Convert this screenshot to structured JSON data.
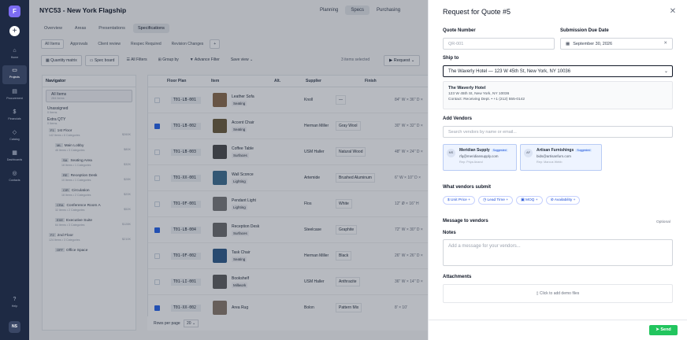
{
  "rail": {
    "logo": "F",
    "items": [
      {
        "label": "Home",
        "icon": "home-icon",
        "glyph": "⌂"
      },
      {
        "label": "Projects",
        "icon": "folder-icon",
        "glyph": "▭"
      },
      {
        "label": "Procurement",
        "icon": "document-icon",
        "glyph": "▤"
      },
      {
        "label": "Financials",
        "icon": "dollar-icon",
        "glyph": "$"
      },
      {
        "label": "Catalog",
        "icon": "box-icon",
        "glyph": "◇"
      },
      {
        "label": "Dashboards",
        "icon": "grid-icon",
        "glyph": "▦"
      },
      {
        "label": "Contacts",
        "icon": "contacts-icon",
        "glyph": "◎"
      }
    ],
    "help_label": "Help",
    "avatar": "NS"
  },
  "header": {
    "title": "NYC53 - New York Flagship",
    "modes": [
      "Planning",
      "Specs",
      "Purchasing"
    ]
  },
  "tabs_primary": [
    "Overview",
    "Areas",
    "Presentations",
    "Specifications"
  ],
  "tabs_secondary": [
    "All Items",
    "Approvals",
    "Client review",
    "Respec Required",
    "Revision Changes"
  ],
  "toolbar": {
    "quantity_matrix": "Quantity matrix",
    "spec_board": "Spec board",
    "all_filters": "All Filters",
    "group_by": "Group by",
    "advance_filter": "Advance Filter",
    "save_view": "Save view",
    "selected_info": "3 items selected",
    "request": "Request"
  },
  "navigator": {
    "title": "Navigator",
    "all_items": {
      "label": "All Items",
      "sub": "284 Items"
    },
    "unassigned": {
      "label": "Unassigned",
      "sub": "0 Items"
    },
    "extra_qty": {
      "label": "Extra QTY",
      "sub": "0 Items"
    },
    "tree": [
      {
        "code": "F1",
        "name": "1st Floor",
        "meta": "142 Items  •  6 Categories",
        "amt": "$260K",
        "indent": 0
      },
      {
        "code": "ML",
        "name": "Main Lobby",
        "meta": "46 Items  •  3 Categories",
        "amt": "$80K",
        "indent": 1
      },
      {
        "code": "SA",
        "name": "Seating Area",
        "meta": "18 Items  •  1 Categories",
        "amt": "$32K",
        "indent": 2
      },
      {
        "code": "RE",
        "name": "Reception Desk",
        "meta": "10 Items  •  1 Categories",
        "amt": "$28K",
        "indent": 2
      },
      {
        "code": "CIR",
        "name": "Circulation",
        "meta": "18 Items  •  2 Categories",
        "amt": "$20K",
        "indent": 2
      },
      {
        "code": "CRA",
        "name": "Conference Room A",
        "meta": "32 Items  •  2 Categories",
        "amt": "$52K",
        "indent": 1
      },
      {
        "code": "EXE",
        "name": "Executive Suite",
        "meta": "64 Items  •  3 Categories",
        "amt": "$128K",
        "indent": 1
      },
      {
        "code": "F2",
        "name": "2nd Floor",
        "meta": "124 Items  •  3 Categories",
        "amt": "$210K",
        "indent": 0
      },
      {
        "code": "OFF",
        "name": "Office Space",
        "meta": "",
        "amt": "",
        "indent": 1
      }
    ]
  },
  "grid": {
    "headers": [
      "Floor Plan",
      "Item",
      "Alt.",
      "Supplier",
      "Finish"
    ],
    "rows": [
      {
        "plan": "T01-LB-001",
        "item": "Leather Sofa",
        "cat": "Seating",
        "alt": "Knoll",
        "sup": "—",
        "fin": "84\" W × 36\" D ×",
        "checked": false,
        "thumb": "#8b6b4a"
      },
      {
        "plan": "T01-LB-002",
        "item": "Accent Chair",
        "cat": "Seating",
        "alt": "Herman Miller",
        "sup": "Gray Wool",
        "fin": "30\" W × 32\" D ×",
        "checked": true,
        "thumb": "#6b5b3a"
      },
      {
        "plan": "T01-LB-003",
        "item": "Coffee Table",
        "cat": "Surfaces",
        "alt": "USM Haller",
        "sup": "Natural Wood",
        "fin": "48\" W × 24\" D ×",
        "checked": false,
        "thumb": "#4a4a4a"
      },
      {
        "plan": "T01-XX-001",
        "item": "Wall Sconce",
        "cat": "Lighting",
        "alt": "Artemide",
        "sup": "Brushed Aluminum",
        "fin": "6\" W × 10\" D ×",
        "checked": false,
        "thumb": "#3d6e8f"
      },
      {
        "plan": "T01-OF-001",
        "item": "Pendant Light",
        "cat": "Lighting",
        "alt": "Flos",
        "sup": "White",
        "fin": "12\" Ø × 16\" H",
        "checked": false,
        "thumb": "#7a7a7a"
      },
      {
        "plan": "T01-LB-004",
        "item": "Reception Desk",
        "cat": "Surfaces",
        "alt": "Steelcase",
        "sup": "Graphite",
        "fin": "72\" W × 30\" D ×",
        "checked": true,
        "thumb": "#6c6c6c"
      },
      {
        "plan": "T01-OF-002",
        "item": "Task Chair",
        "cat": "Seating",
        "alt": "Herman Miller",
        "sup": "Black",
        "fin": "26\" W × 26\" D ×",
        "checked": false,
        "thumb": "#2e5a8a"
      },
      {
        "plan": "T01-LI-001",
        "item": "Bookshelf",
        "cat": "Millwork",
        "alt": "USM Haller",
        "sup": "Anthracite",
        "fin": "36\" W × 14\" D ×",
        "checked": false,
        "thumb": "#5e5e5e"
      },
      {
        "plan": "T01-XX-002",
        "item": "Area Rug",
        "cat": "",
        "alt": "Bolon",
        "sup": "Pattern Mix",
        "fin": "8' × 10'",
        "checked": true,
        "thumb": "#8a7a6a"
      }
    ],
    "rows_per_page_label": "Rows per page",
    "rows_per_page": "20"
  },
  "panel": {
    "title": "Request for Quote #5",
    "quote_number_label": "Quote Number",
    "quote_number_placeholder": "QR-001",
    "due_label": "Submission Due Date",
    "due_value": "September 30, 2026",
    "ship_to_label": "Ship to",
    "ship_to_value": "The Waverly Hotel — 123 W 45th St, New York, NY 10036",
    "address": {
      "name": "The Waverly Hotel",
      "line1": "123 W 45th St, New York, NY 10036",
      "line2": "Contact: Receiving Dept.  •  +1 (212) 555-0142"
    },
    "add_vendors_label": "Add Vendors",
    "vendor_search_placeholder": "Search vendors by name or email...",
    "vendors": [
      {
        "initials": "MS",
        "name": "Meridian Supply",
        "badge": "Suggested",
        "email": "rfq@meridiansupply.com",
        "rep": "Rep: Priya Anand"
      },
      {
        "initials": "AF",
        "name": "Artisan Furnishings",
        "badge": "Suggested",
        "email": "bids@artisanfurn.com",
        "rep": "Rep: Marcus Webb"
      }
    ],
    "vendors_submit_label": "What vendors submit",
    "submit_chips": [
      {
        "icon": "dollar-icon",
        "glyph": "$",
        "label": "Unit Price"
      },
      {
        "icon": "clock-icon",
        "glyph": "◷",
        "label": "Lead Time"
      },
      {
        "icon": "box-icon",
        "glyph": "▣",
        "label": "MOQ"
      },
      {
        "icon": "check-circle-icon",
        "glyph": "⊘",
        "label": "Availability"
      }
    ],
    "message_label": "Message to vendors",
    "optional_label": "Optional",
    "notes_label": "Notes",
    "notes_placeholder": "Add a message for your vendors...",
    "attachments_label": "Attachments",
    "attachments_cta": "Click to add demo files",
    "send_label": "Send"
  }
}
